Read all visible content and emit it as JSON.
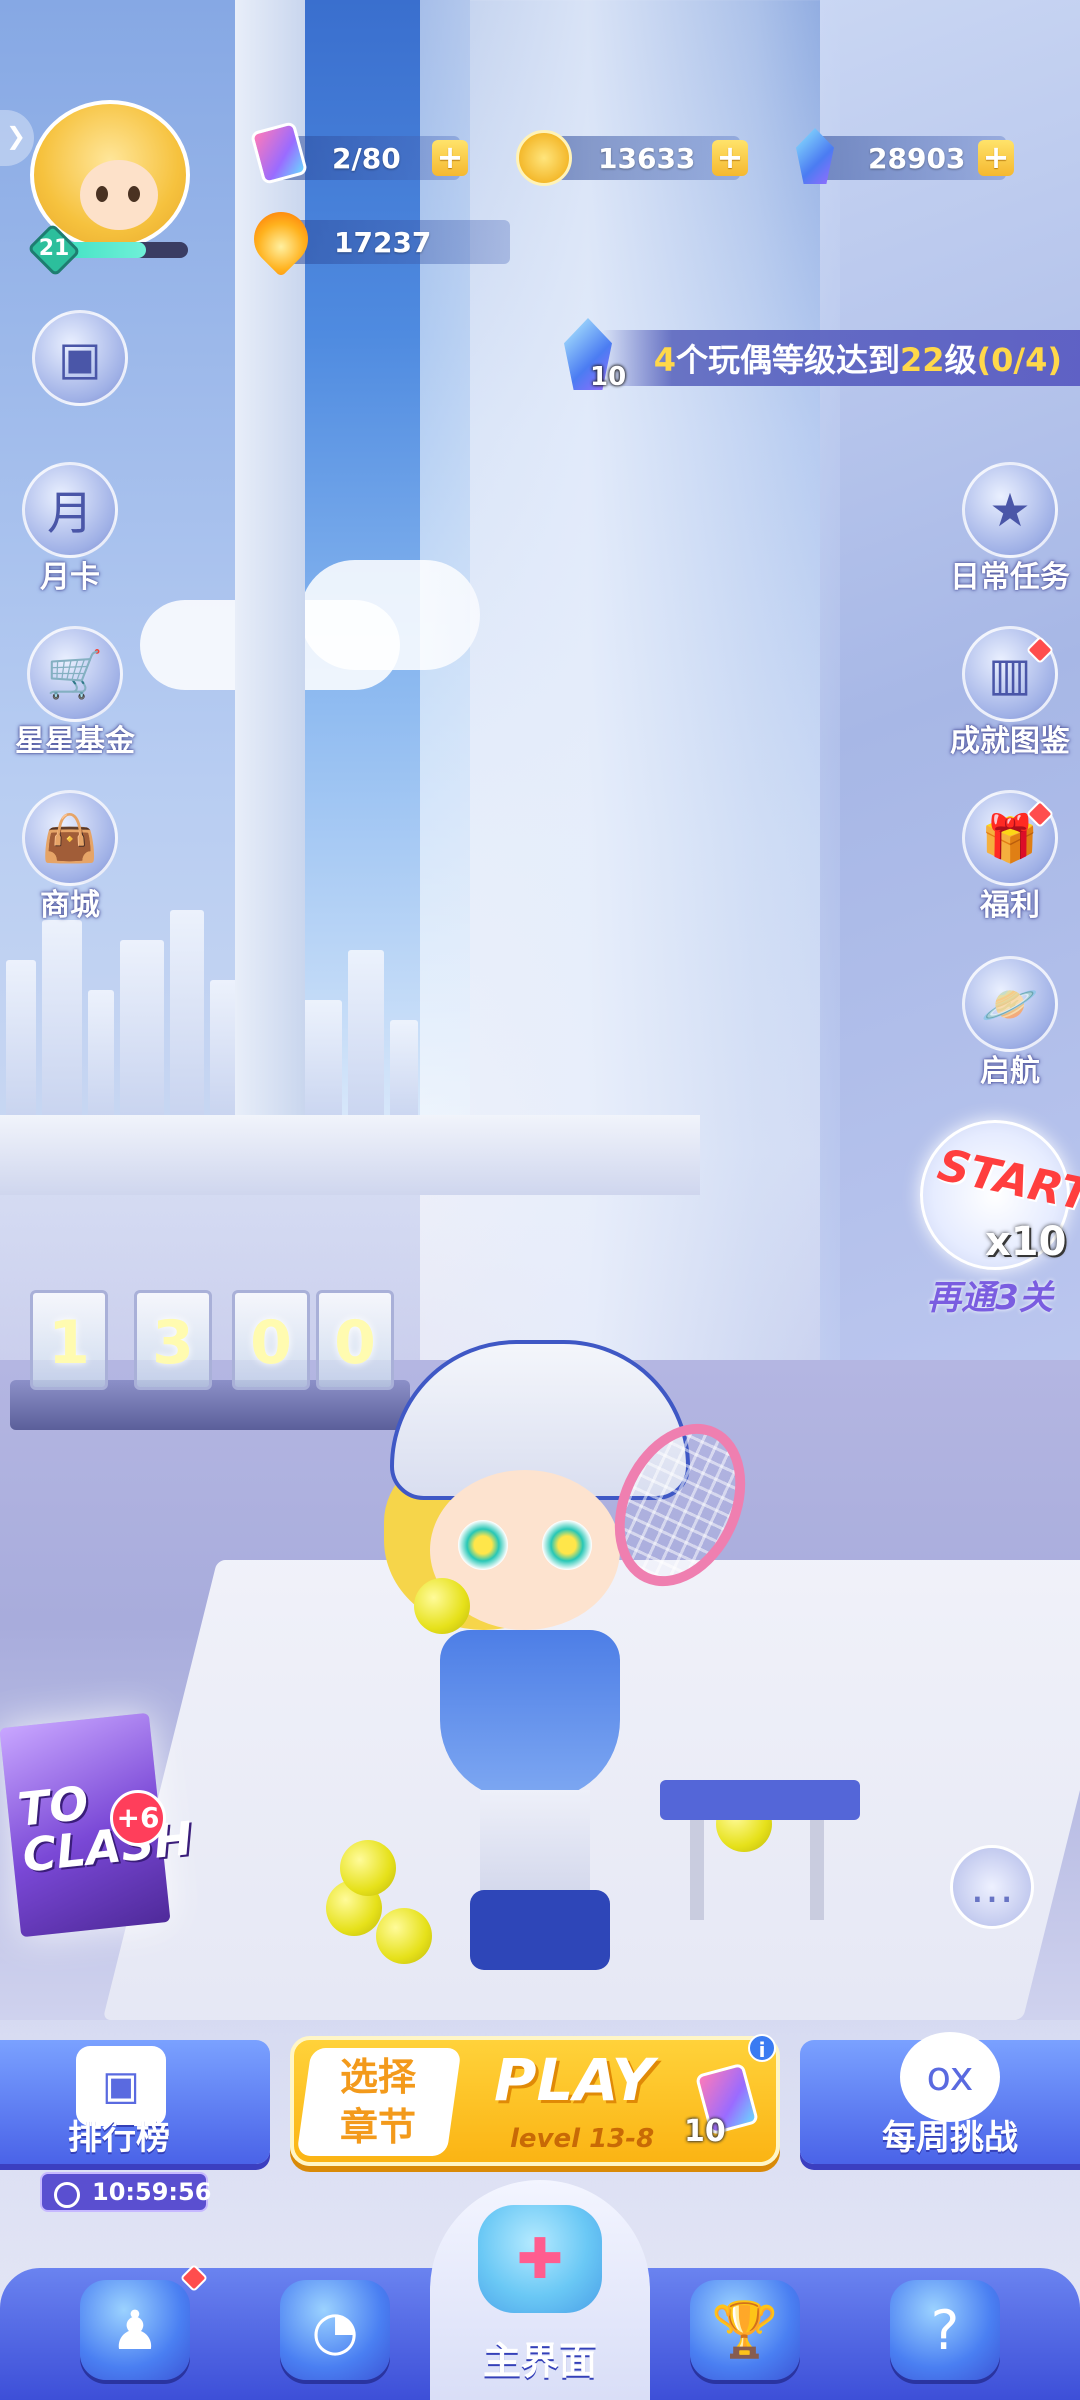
{
  "player": {
    "level": "21",
    "level_progress": 0.7,
    "avatar_icon": "blonde-doll-avatar"
  },
  "resources": {
    "tickets": "2/80",
    "coins": "13633",
    "crystals": "28903",
    "flame_points": "17237",
    "plus_symbol": "+"
  },
  "quest": {
    "reward": "10",
    "count_prefix": "4",
    "text_mid": "个玩偶等级达到",
    "target_level": "22",
    "text_suffix": "级",
    "progress": "(0/4)"
  },
  "left_menu": [
    {
      "label": "",
      "icon": "cube-face-icon"
    },
    {
      "label": "月卡",
      "icon": "month-card-icon"
    },
    {
      "label": "星星基金",
      "icon": "shopping-cart-icon"
    },
    {
      "label": "商城",
      "icon": "shopping-bag-icon"
    }
  ],
  "right_menu": [
    {
      "label": "日常任务",
      "icon": "calendar-star-icon"
    },
    {
      "label": "成就图鉴",
      "icon": "book-icon"
    },
    {
      "label": "福利",
      "icon": "gift-icon"
    },
    {
      "label": "启航",
      "icon": "planet-icon"
    }
  ],
  "start_bonus": {
    "badge": "START",
    "multiplier": "x10",
    "caption": "再通3关"
  },
  "score_counter": [
    "1",
    "3",
    "0",
    "0"
  ],
  "gift_box": {
    "text_line1": "TO",
    "text_line2": "CLASH",
    "badge": "+6"
  },
  "actions": {
    "leaderboard_label": "排行榜",
    "timer": "10:59:56",
    "weekly_label": "每周挑战",
    "weekly_icon_text": "ox"
  },
  "play_button": {
    "chapter_line1": "选择",
    "chapter_line2": "章节",
    "title": "PLAY",
    "level": "level 13-8",
    "cost": "10",
    "info": "i"
  },
  "bottom_nav": {
    "home_label": "主界面",
    "items": [
      "doll-collection-icon",
      "whistle-icon",
      "trophy-icon",
      "slot-machine-icon"
    ]
  },
  "colors": {
    "highlight_yellow": "#ffd84a",
    "play_yellow": "#fbb414",
    "nav_blue": "#3d4fd8",
    "badge_red": "#ff4d4d"
  }
}
